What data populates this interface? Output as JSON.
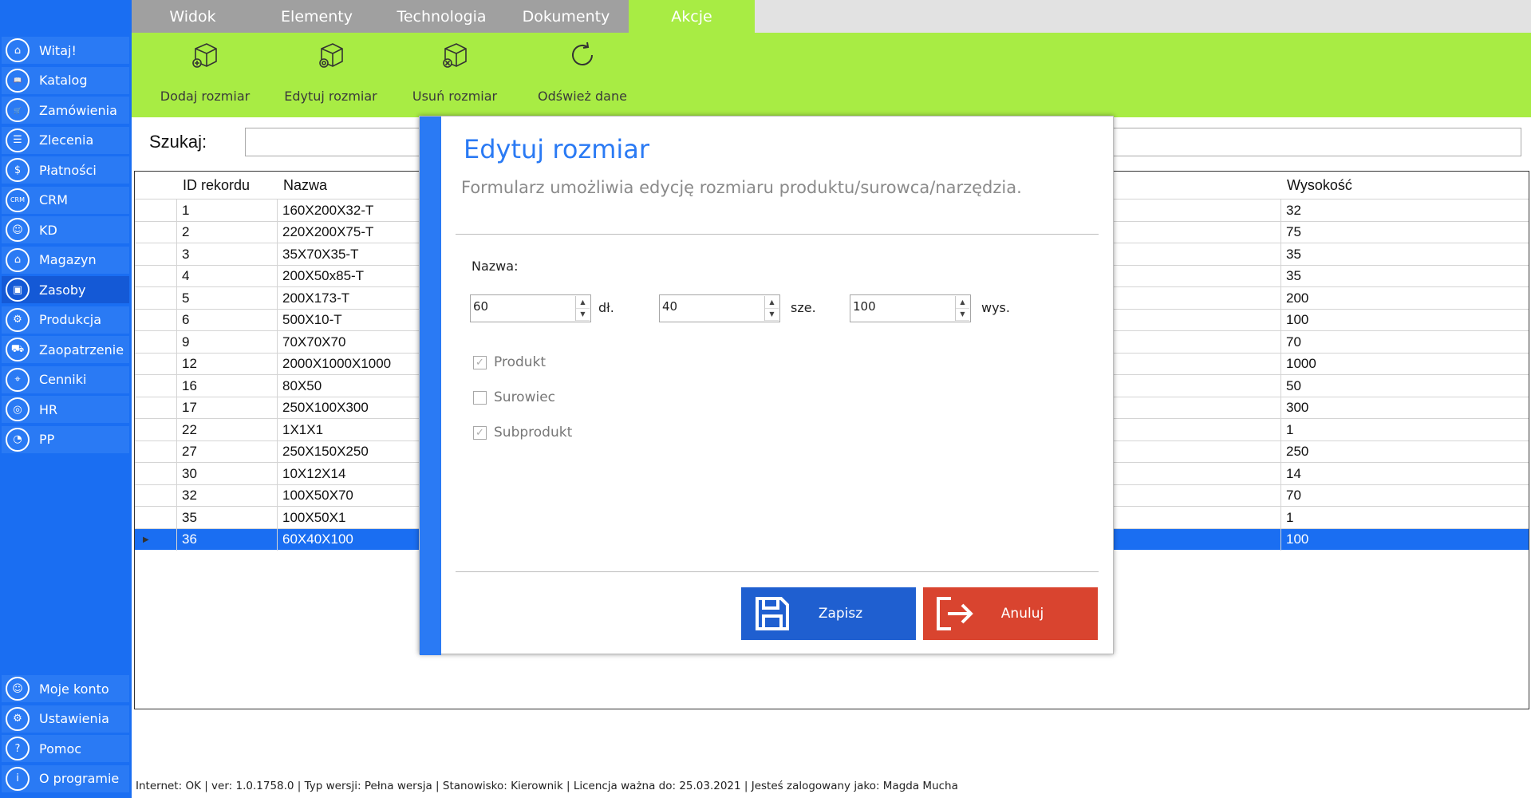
{
  "sidebar": {
    "top_items": [
      {
        "label": "Witaj!",
        "icon": "home-icon",
        "glyph": "⌂"
      },
      {
        "label": "Katalog",
        "icon": "book-icon",
        "glyph": "📖"
      },
      {
        "label": "Zamówienia",
        "icon": "cart-icon",
        "glyph": "🛒"
      },
      {
        "label": "Zlecenia",
        "icon": "list-icon",
        "glyph": "☰"
      },
      {
        "label": "Płatności",
        "icon": "dollar-icon",
        "glyph": "$"
      },
      {
        "label": "CRM",
        "icon": "crm-icon",
        "glyph": "CRM"
      },
      {
        "label": "KD",
        "icon": "person-icon",
        "glyph": "☺"
      },
      {
        "label": "Magazyn",
        "icon": "warehouse-icon",
        "glyph": "⌂"
      },
      {
        "label": "Zasoby",
        "icon": "resources-icon",
        "glyph": "▣"
      },
      {
        "label": "Produkcja",
        "icon": "production-icon",
        "glyph": "⚙"
      },
      {
        "label": "Zaopatrzenie",
        "icon": "truck-icon",
        "glyph": "⛟"
      },
      {
        "label": "Cenniki",
        "icon": "tag-icon",
        "glyph": "⌖"
      },
      {
        "label": "HR",
        "icon": "fingerprint-icon",
        "glyph": "◎"
      },
      {
        "label": "PP",
        "icon": "chart-icon",
        "glyph": "◔"
      }
    ],
    "bottom_items": [
      {
        "label": "Moje konto",
        "icon": "user-icon",
        "glyph": "☺"
      },
      {
        "label": "Ustawienia",
        "icon": "gear-icon",
        "glyph": "⚙"
      },
      {
        "label": "Pomoc",
        "icon": "help-icon",
        "glyph": "?"
      },
      {
        "label": "O programie",
        "icon": "info-icon",
        "glyph": "i"
      }
    ],
    "active_index": 8
  },
  "tabs": [
    "Widok",
    "Elementy",
    "Technologia",
    "Dokumenty",
    "Akcje"
  ],
  "active_tab": "Akcje",
  "ribbon": {
    "add": "Dodaj rozmiar",
    "edit": "Edytuj rozmiar",
    "delete": "Usuń rozmiar",
    "refresh": "Odśwież dane"
  },
  "search": {
    "label": "Szukaj:",
    "value": ""
  },
  "grid": {
    "columns": {
      "id": "ID rekordu",
      "name": "Nazwa",
      "height": "Wysokość"
    },
    "rows": [
      {
        "id": "1",
        "name": "160X200X32-T",
        "height": "32"
      },
      {
        "id": "2",
        "name": "220X200X75-T",
        "height": "75"
      },
      {
        "id": "3",
        "name": "35X70X35-T",
        "height": "35"
      },
      {
        "id": "4",
        "name": "200X50x85-T",
        "height": "35"
      },
      {
        "id": "5",
        "name": "200X173-T",
        "height": "200"
      },
      {
        "id": "6",
        "name": "500X10-T",
        "height": "100"
      },
      {
        "id": "9",
        "name": "70X70X70",
        "height": "70"
      },
      {
        "id": "12",
        "name": "2000X1000X1000",
        "height": "1000"
      },
      {
        "id": "16",
        "name": "80X50",
        "height": "50"
      },
      {
        "id": "17",
        "name": "250X100X300",
        "height": "300"
      },
      {
        "id": "22",
        "name": "1X1X1",
        "height": "1"
      },
      {
        "id": "27",
        "name": "250X150X250",
        "height": "250"
      },
      {
        "id": "30",
        "name": "10X12X14",
        "height": "14"
      },
      {
        "id": "32",
        "name": "100X50X70",
        "height": "70"
      },
      {
        "id": "35",
        "name": "100X50X1",
        "height": "1"
      },
      {
        "id": "36",
        "name": "60X40X100",
        "height": "100"
      }
    ],
    "selected_row_index": 15
  },
  "dialog": {
    "title": "Edytuj rozmiar",
    "subtitle": "Formularz umożliwia edycję rozmiaru produktu/surowca/narzędzia.",
    "name_label": "Nazwa:",
    "length": {
      "value": "60",
      "unit": "dł."
    },
    "width": {
      "value": "40",
      "unit": "sze."
    },
    "height": {
      "value": "100",
      "unit": "wys."
    },
    "checkboxes": [
      {
        "label": "Produkt",
        "checked": true
      },
      {
        "label": "Surowiec",
        "checked": false
      },
      {
        "label": "Subprodukt",
        "checked": true
      }
    ],
    "save_label": "Zapisz",
    "cancel_label": "Anuluj"
  },
  "colors": {
    "sidebar": "#1a6ef2",
    "accent_green": "#a8ec44",
    "dialog_blue": "#2a7af4",
    "cancel_red": "#d9442f",
    "save_blue": "#1f5fd0"
  },
  "status_bar": "Internet: OK  |   ver: 1.0.1758.0   |   Typ wersji: Pełna wersja   |   Stanowisko: Kierownik   |   Licencja ważna do: 25.03.2021   |   Jesteś zalogowany jako: Magda Mucha"
}
